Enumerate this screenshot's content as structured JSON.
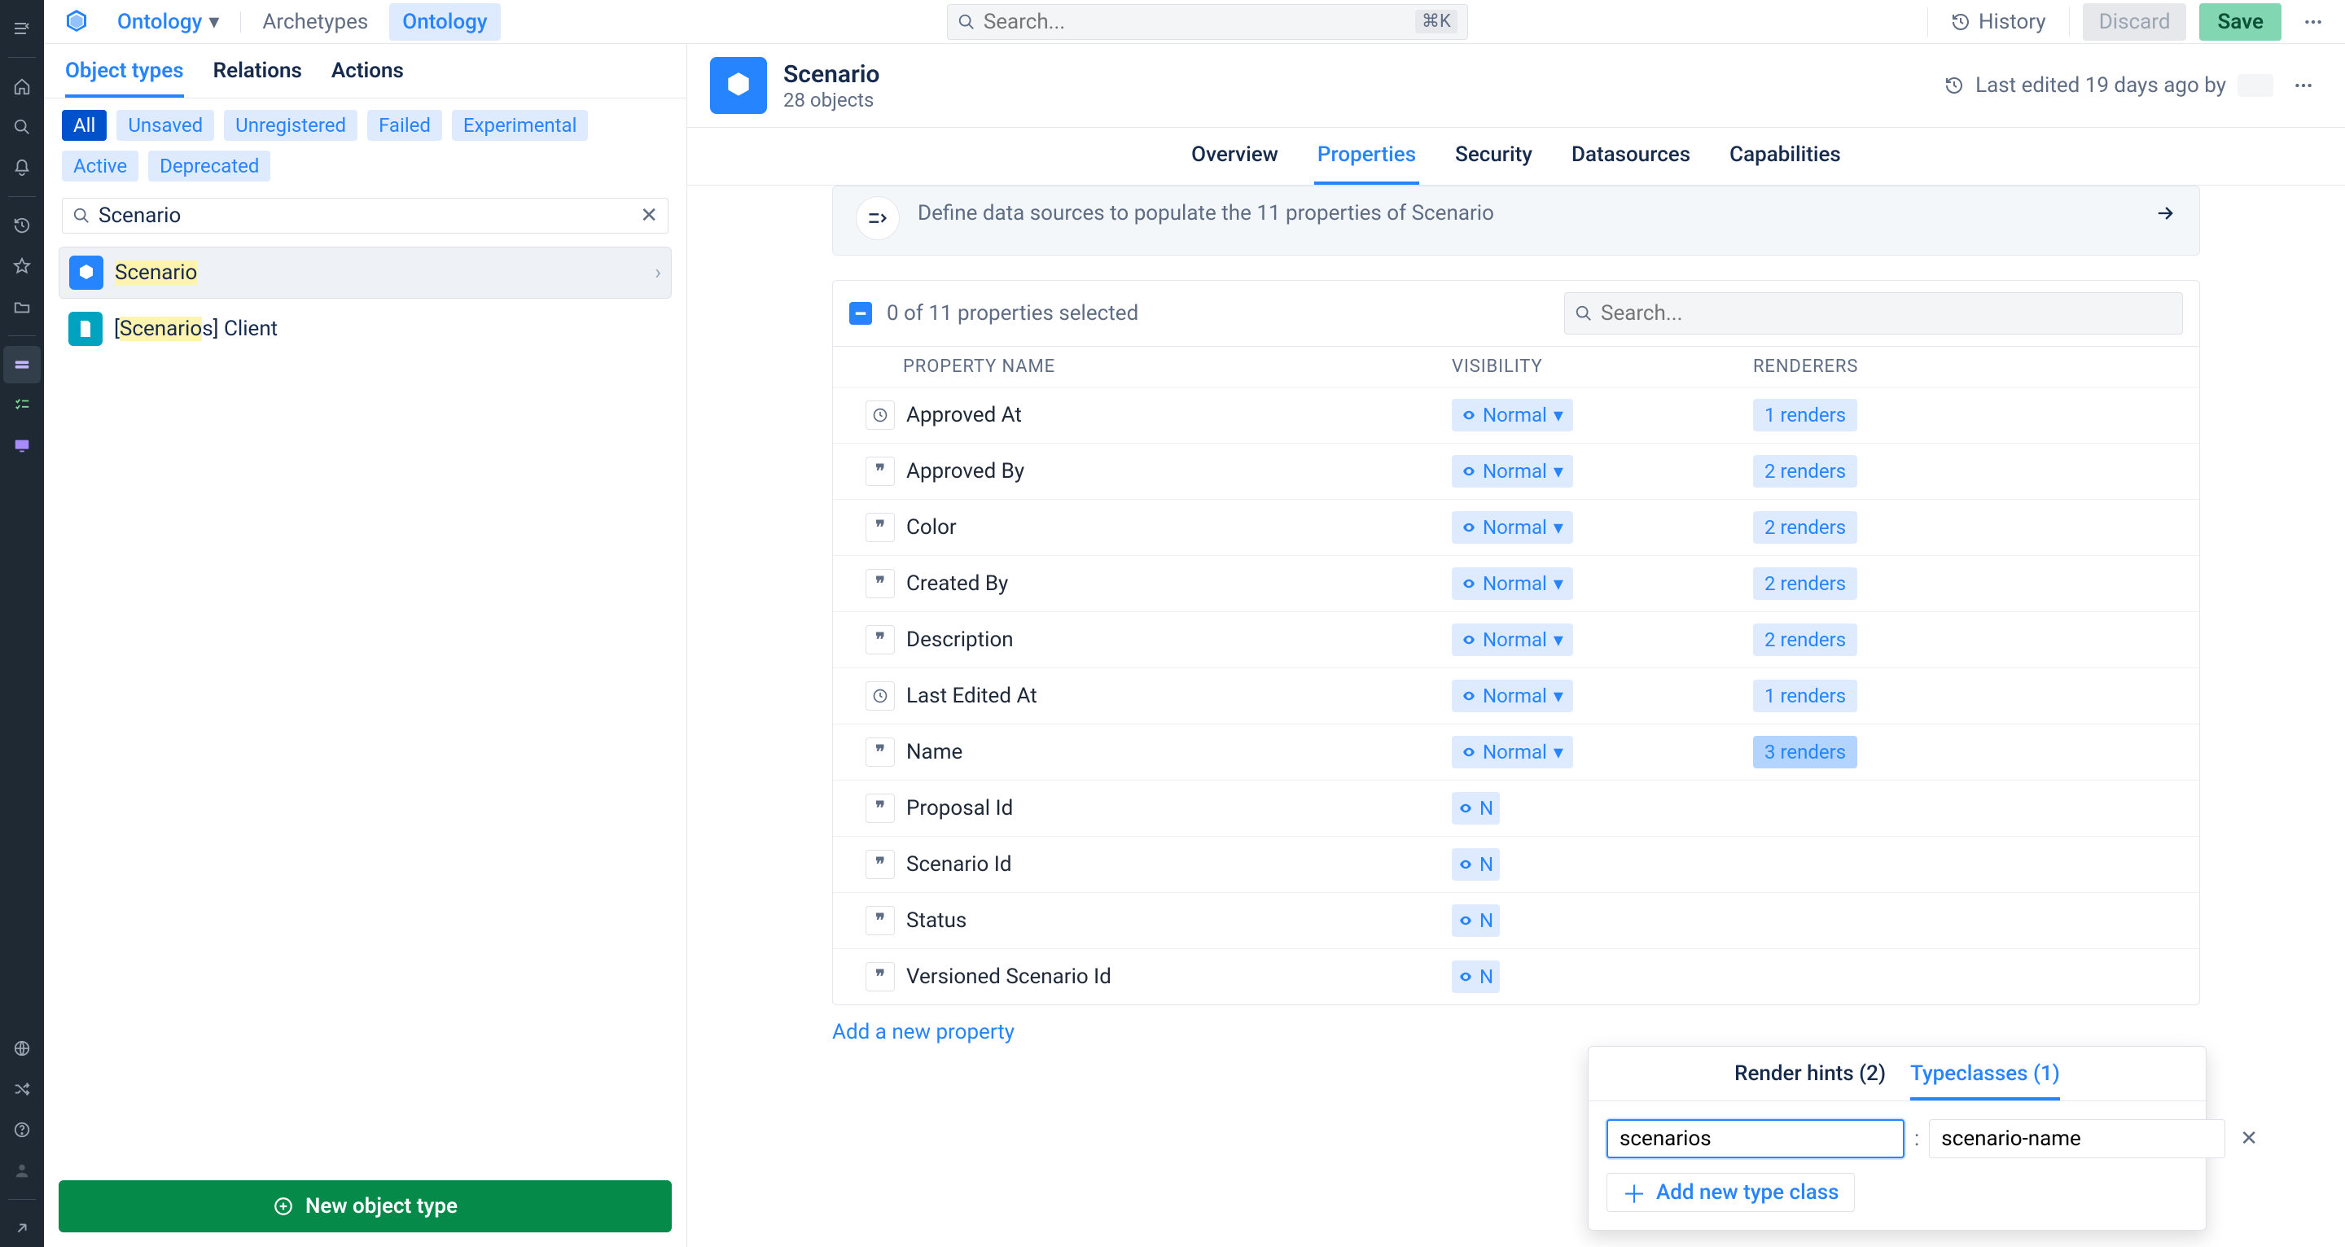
{
  "topbar": {
    "brand_crumb": "Ontology",
    "archetypes": "Archetypes",
    "ontology_pill": "Ontology",
    "search_placeholder": "Search...",
    "search_kbd": "⌘K",
    "history": "History",
    "discard": "Discard",
    "save": "Save"
  },
  "leftpane": {
    "tabs": {
      "object_types": "Object types",
      "relations": "Relations",
      "actions": "Actions"
    },
    "chips": [
      "All",
      "Unsaved",
      "Unregistered",
      "Failed",
      "Experimental",
      "Active",
      "Deprecated"
    ],
    "search_value": "Scenario",
    "results": {
      "scenario_hl": "Scenario",
      "scenarios_hl": "Scenario",
      "scenarios_suffix": "s] Client",
      "scenarios_prefix": "["
    },
    "new_type": "New object type"
  },
  "rightpane": {
    "title": "Scenario",
    "subtitle": "28 objects",
    "last_edited_pre": "Last edited 19 days ago by",
    "tabs": {
      "overview": "Overview",
      "properties": "Properties",
      "security": "Security",
      "datasources": "Datasources",
      "capabilities": "Capabilities"
    },
    "banner": {
      "text": "Define data sources to populate the 11 properties of Scenario"
    },
    "prop_head": {
      "selected": "0 of 11 properties selected",
      "search_placeholder": "Search..."
    },
    "cols": {
      "name": "PROPERTY NAME",
      "vis": "VISIBILITY",
      "renderers": "RENDERERS"
    },
    "rows": [
      {
        "type": "time",
        "name": "Approved At",
        "visibility": "Normal",
        "renders": "1 renders"
      },
      {
        "type": "str",
        "name": "Approved By",
        "visibility": "Normal",
        "renders": "2 renders"
      },
      {
        "type": "str",
        "name": "Color",
        "visibility": "Normal",
        "renders": "2 renders"
      },
      {
        "type": "str",
        "name": "Created By",
        "visibility": "Normal",
        "renders": "2 renders"
      },
      {
        "type": "str",
        "name": "Description",
        "visibility": "Normal",
        "renders": "2 renders"
      },
      {
        "type": "time",
        "name": "Last Edited At",
        "visibility": "Normal",
        "renders": "1 renders"
      },
      {
        "type": "str",
        "name": "Name",
        "visibility": "Normal",
        "renders": "3 renders",
        "emph": true
      },
      {
        "type": "str",
        "name": "Proposal Id",
        "visibility": "N",
        "renders": "",
        "trunc": true
      },
      {
        "type": "str",
        "name": "Scenario Id",
        "visibility": "N",
        "renders": "",
        "trunc": true
      },
      {
        "type": "str",
        "name": "Status",
        "visibility": "N",
        "renders": "",
        "trunc": true
      },
      {
        "type": "str",
        "name": "Versioned Scenario Id",
        "visibility": "N",
        "renders": "",
        "trunc": true
      }
    ],
    "add_prop": "Add a new property"
  },
  "popover": {
    "tabs": {
      "hints": "Render hints (2)",
      "typeclasses": "Typeclasses (1)"
    },
    "input1": "scenarios",
    "input2": "scenario-name",
    "add": "Add new type class"
  }
}
